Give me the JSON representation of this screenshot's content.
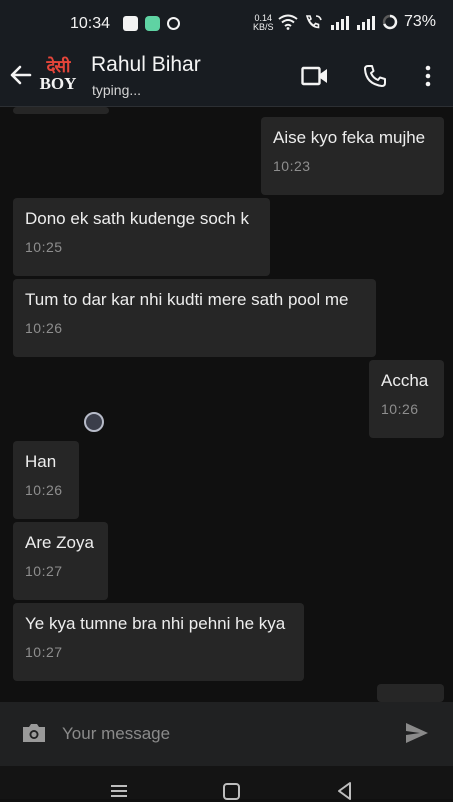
{
  "status_bar": {
    "time": "10:34",
    "net_speed_value": "0.14",
    "net_speed_unit": "KB/S",
    "battery": "73%"
  },
  "header": {
    "avatar_top": "देसी",
    "avatar_bottom": "BOY",
    "contact_name": "Rahul Bihar",
    "contact_status": "typing..."
  },
  "messages": [
    {
      "direction": "out",
      "text": "Aise kyo feka mujhe",
      "time": "10:23"
    },
    {
      "direction": "in",
      "text": "Dono ek sath kudenge soch k",
      "time": "10:25"
    },
    {
      "direction": "in",
      "text": "Tum to dar kar nhi kudti mere sath pool me",
      "time": "10:26"
    },
    {
      "direction": "out",
      "text": "Accha",
      "time": "10:26"
    },
    {
      "direction": "in",
      "text": "Han",
      "time": "10:26"
    },
    {
      "direction": "in",
      "text": "Are Zoya",
      "time": "10:27"
    },
    {
      "direction": "in",
      "text": "Ye kya tumne bra nhi pehni he kya",
      "time": "10:27"
    }
  ],
  "input": {
    "placeholder": "Your message"
  },
  "colors": {
    "background": "#101010",
    "bubble": "#262626",
    "header": "#181c21",
    "accent_red": "#e5453a"
  }
}
